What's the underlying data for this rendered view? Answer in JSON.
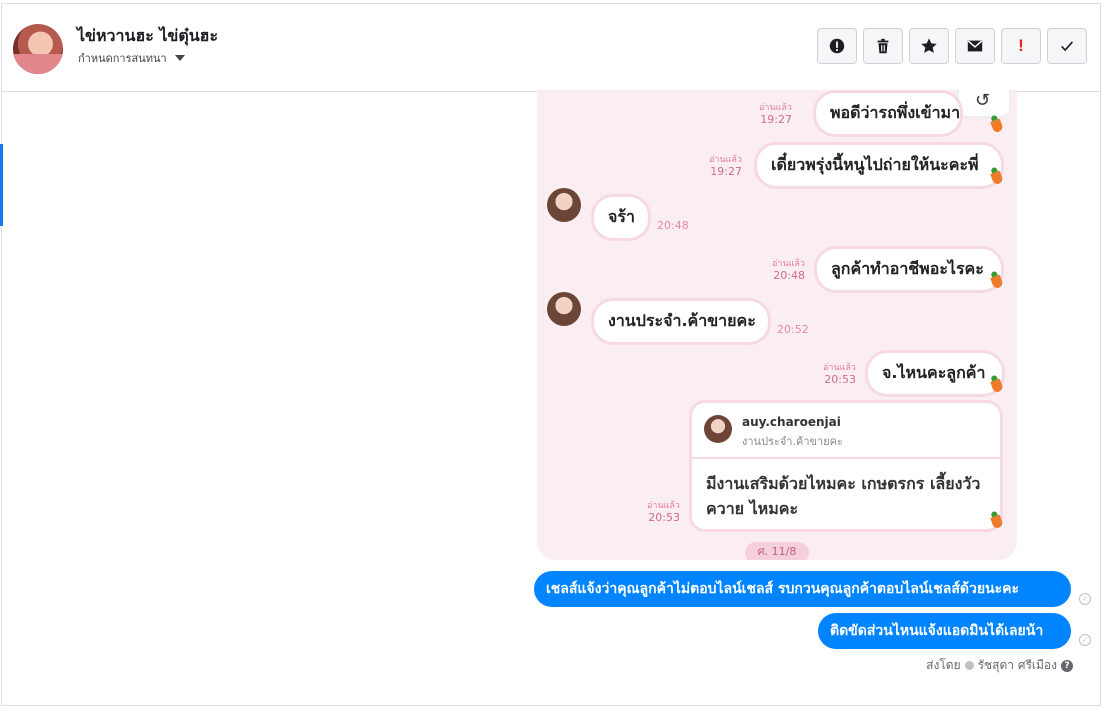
{
  "header": {
    "contact_name": "ไข่หวานฮะ ไข่ตุ๋นฮะ",
    "thread_settings_label": "กำหนดการสนทนา"
  },
  "toolbar": {
    "buttons": [
      {
        "name": "report-spam",
        "icon": "exclamation-circle-icon"
      },
      {
        "name": "delete",
        "icon": "trash-icon"
      },
      {
        "name": "star",
        "icon": "star-icon"
      },
      {
        "name": "mark-unread",
        "icon": "envelope-icon"
      },
      {
        "name": "important",
        "icon": "exclamation-icon",
        "glyph": "!"
      },
      {
        "name": "done",
        "icon": "check-icon"
      }
    ]
  },
  "screenshot": {
    "rows": [
      {
        "read": "อ่านแล้ว",
        "time": "19:27",
        "text": "พอดีว่ารถพึ่งเข้ามา"
      },
      {
        "read": "อ่านแล้ว",
        "time": "19:27",
        "text": "เดี๋ยวพรุ่งนี้หนูไปถ่ายให้นะคะพี่"
      },
      {
        "text": "จร้า",
        "time": "20:48"
      },
      {
        "read": "อ่านแล้ว",
        "time": "20:48",
        "text": "ลูกค้าทำอาชีพอะไรคะ"
      },
      {
        "text": "งานประจำ.ค้าขายคะ",
        "time": "20:52"
      },
      {
        "read": "อ่านแล้ว",
        "time": "20:53",
        "text": "จ.ไหนคะลูกค้า"
      }
    ],
    "card": {
      "username": "auy.charoenjai",
      "bio": "งานประจำ.ค้าขายคะ",
      "text": "มีงานเสริมด้วยไหมคะ เกษตรกร เลี้ยงวัว ควาย ไหมคะ",
      "read": "อ่านแล้ว",
      "time": "20:53"
    },
    "date_chip": "ศ. 11/8"
  },
  "messages": [
    {
      "text": "เชลส์แจ้งว่าคุณลูกค้าไม่ตอบไลน์เชลส์  รบกวนคุณลูกค้าตอบไลน์เชลส์ด้วยนะคะ"
    },
    {
      "text": "ติดขัดส่วนไหนแจ้งแอดมินได้เลยน้า"
    }
  ],
  "sent_by": {
    "label": "ส่งโดย",
    "name": "รัชสุดา ศรีเมือง",
    "help": "?"
  }
}
